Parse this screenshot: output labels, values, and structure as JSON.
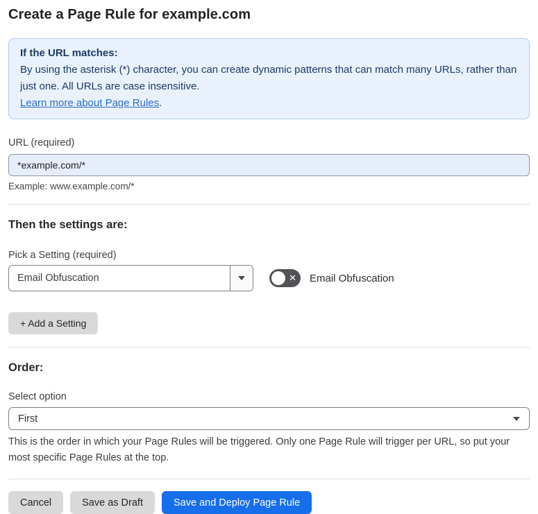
{
  "page": {
    "title": "Create a Page Rule for example.com"
  },
  "info_box": {
    "heading": "If the URL matches:",
    "body": "By using the asterisk (*) character, you can create dynamic patterns that can match many URLs, rather than just one. All URLs are case insensitive.",
    "link_label": "Learn more about Page Rules",
    "link_suffix": "."
  },
  "url_field": {
    "label": "URL (required)",
    "value": "*example.com/*",
    "hint": "Example: www.example.com/*"
  },
  "settings_section": {
    "heading": "Then the settings are:",
    "picker_label": "Pick a Setting (required)",
    "picker_value": "Email Obfuscation",
    "toggle_label": "Email Obfuscation",
    "toggle_state": "off",
    "toggle_x_glyph": "✕",
    "add_setting_label": "+ Add a Setting"
  },
  "order_section": {
    "heading": "Order:",
    "select_label": "Select option",
    "select_value": "First",
    "description": "This is the order in which your Page Rules will be triggered. Only one Page Rule will trigger per URL, so put your most specific Page Rules at the top."
  },
  "footer": {
    "cancel_label": "Cancel",
    "save_draft_label": "Save as Draft",
    "save_deploy_label": "Save and Deploy Page Rule"
  },
  "colors": {
    "info_bg": "#e9f2fc",
    "info_border": "#abcaec",
    "info_text": "#1b3a66",
    "link_blue": "#2b6cc9",
    "input_bg": "#e7eefb",
    "primary_button_bg": "#166eeb",
    "gray_button_bg": "#d9d9d9",
    "toggle_off_bg": "#525356"
  }
}
